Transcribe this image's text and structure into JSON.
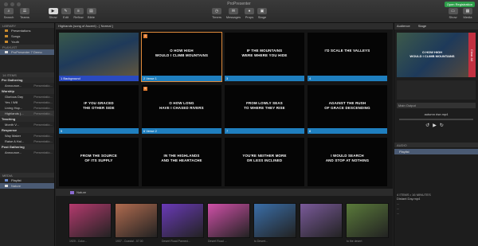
{
  "window": {
    "title": "ProPresenter",
    "registration": "Open Registration"
  },
  "toolbar": {
    "left_buttons": [
      {
        "label": "Show",
        "icon": "play-icon"
      },
      {
        "label": "Edit",
        "icon": "pencil-icon"
      },
      {
        "label": "Reflow",
        "icon": "reflow-icon"
      },
      {
        "label": "Bible",
        "icon": "bible-icon"
      }
    ],
    "search_label": "Search",
    "teams_label": "Teams",
    "center_buttons": [
      {
        "label": "Timers",
        "icon": "clock-icon"
      },
      {
        "label": "Messages",
        "icon": "message-icon"
      },
      {
        "label": "Props",
        "icon": "mic-icon"
      },
      {
        "label": "Stage",
        "icon": "stage-icon"
      }
    ],
    "right_buttons": [
      {
        "label": "Show",
        "icon": "screen-icon"
      },
      {
        "label": "Media",
        "icon": "media-icon"
      }
    ]
  },
  "library": {
    "header": "LIBRARY",
    "items": [
      "Presentations",
      "Songs",
      "Youth"
    ],
    "playlist_header": "PLAYLIST",
    "playlist_item": "ProPresenter 7 Demo",
    "items_header": "14 ITEMS",
    "groups": [
      {
        "name": "Pre Gathering",
        "rows": [
          [
            "Announce...",
            "Presentatio..."
          ]
        ]
      },
      {
        "name": "Worship",
        "rows": [
          [
            "Glorious Day",
            "Presentatio..."
          ],
          [
            "Yes I Will",
            "Presentatio..."
          ],
          [
            "Living Hop...",
            "Presentatio..."
          ],
          [
            "Highlands (...",
            "Presentatio..."
          ]
        ]
      },
      {
        "name": "Teaching",
        "rows": [
          [
            "Month V...",
            "Presentatio..."
          ]
        ]
      },
      {
        "name": "Response",
        "rows": [
          [
            "Way Maker",
            "Presentatio..."
          ],
          [
            "Raise A Hal...",
            "Presentatio..."
          ]
        ]
      },
      {
        "name": "Post Gathering",
        "rows": [
          [
            "Announce...",
            "Presentatio..."
          ]
        ]
      }
    ],
    "media_header": "MEDIA",
    "media_items": [
      "Playlist",
      "Nature"
    ]
  },
  "presentation": {
    "title": "Highlands (song of Ascent) - [ Normal ]",
    "slides": [
      {
        "num": "1",
        "label": "Background",
        "text": ""
      },
      {
        "num": "2",
        "label": "Verse 1",
        "text": "O HOW HIGH\nWOULD I CLIMB MOUNTAINS"
      },
      {
        "num": "3",
        "label": "",
        "text": "IF THE MOUNTAINS\nWERE WHERE YOU HIDE"
      },
      {
        "num": "4",
        "label": "",
        "text": "I'D SCALE THE VALLEYS"
      },
      {
        "num": "5",
        "label": "",
        "text": "IF YOU GRACED\nTHE OTHER SIDE"
      },
      {
        "num": "6",
        "label": "Verse 2",
        "text": "O HOW LONG\nHAVE I CHASED RIVERS"
      },
      {
        "num": "7",
        "label": "",
        "text": "FROM LOWLY SEAS\nTO WHERE THEY RISE"
      },
      {
        "num": "8",
        "label": "",
        "text": "AGAINST THE RUSH\nOF GRACE DESCENDING"
      },
      {
        "num": "",
        "label": "",
        "text": "FROM THE SOURCE\nOF ITS SUPPLY"
      },
      {
        "num": "",
        "label": "",
        "text": "IN THE HIGHLANDS\nAND THE HEARTACHE"
      },
      {
        "num": "",
        "label": "",
        "text": "YOU'RE NEITHER MORE\nOR LESS INCLINED"
      },
      {
        "num": "",
        "label": "",
        "text": "I WOULD SEARCH\nAND STOP AT NOTHING"
      }
    ]
  },
  "right_panel": {
    "audience": "Audience",
    "stage": "Stage",
    "preview_text": "O HOW HIGH\nWOULD I CLIMB MOUNTAINS",
    "clear_all": "Clear All",
    "output_label": "Main Output",
    "audio_file": "autumn rise.mp4",
    "audio_header": "AUDIO",
    "audio_item": "Playlist",
    "footer": "4 ITEMS • 16 MINUTES",
    "tracks": [
      "Distant Day.mp4",
      "...",
      "...",
      "..."
    ]
  },
  "media": {
    "header": "Nature",
    "thumbs": [
      {
        "cap": "1920 - Color...",
        "color": "#b43a6e"
      },
      {
        "cap": "1937 - Coastal - 07.00",
        "color": "#b06b4f"
      },
      {
        "cap": "Desert Road Panned...",
        "color": "#6a3ab8"
      },
      {
        "cap": "Desert Road ...",
        "color": "#d050a8"
      },
      {
        "cap": "to Desert...",
        "color": "#3a6ea8"
      },
      {
        "cap": "",
        "color": "#7a5a9a"
      },
      {
        "cap": "to the desert",
        "color": "#5a7a3a"
      }
    ]
  }
}
